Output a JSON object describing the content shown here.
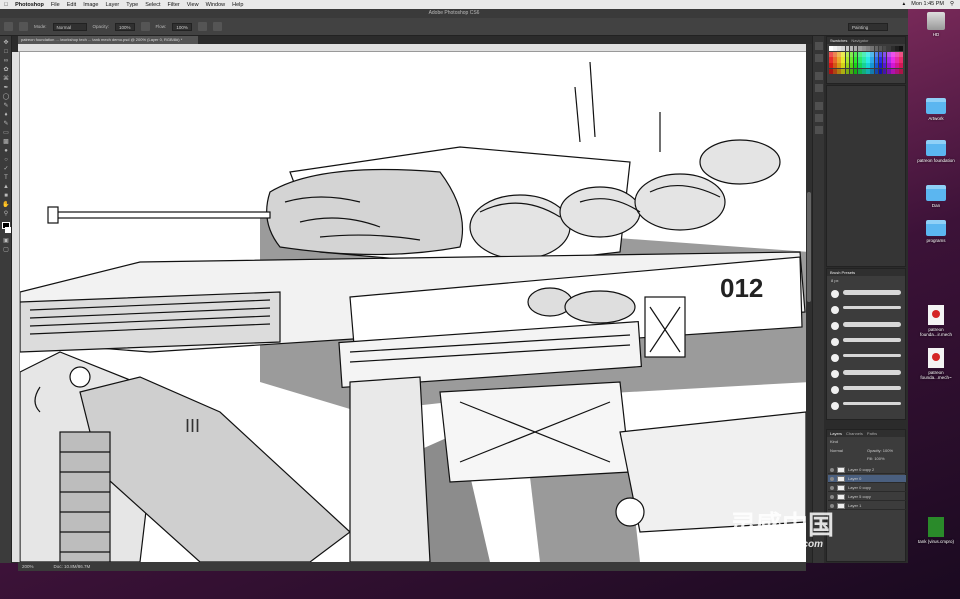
{
  "menubar": {
    "app": "Photoshop",
    "items": [
      "File",
      "Edit",
      "Image",
      "Layer",
      "Type",
      "Select",
      "Filter",
      "View",
      "Window",
      "Help"
    ],
    "clock": "Mon 1:45 PM"
  },
  "window": {
    "title": "Adobe Photoshop CS6"
  },
  "options": {
    "mode_label": "Mode:",
    "mode_value": "Normal",
    "opacity_label": "Opacity:",
    "opacity_value": "100%",
    "flow_label": "Flow:",
    "flow_value": "100%",
    "workspace": "Painting"
  },
  "document": {
    "tab_label": "patreon foundation ... /workshop tech ... tank mech demo.psd @ 200% (Layer 0, RGB/8#) *",
    "status_zoom": "200%",
    "status_doc": "Doc: 10.8M/86.7M"
  },
  "panels": {
    "swatches_tabs": [
      "Swatches",
      "Navigator"
    ],
    "brush_tabs": [
      "Brush Presets"
    ],
    "brush_size": "8 px",
    "layers_tabs": [
      "Layers",
      "Channels",
      "Paths"
    ],
    "layers_kind": "Kind",
    "layers_mode": "Normal",
    "layers_opacity": "Opacity: 100%",
    "layers_fill": "Fill: 100%",
    "layers": [
      "Layer 0 copy 2",
      "Layer 0",
      "Layer 0 copy",
      "Layer 5 copy",
      "Layer 1"
    ]
  },
  "desktop": {
    "items": [
      {
        "label": "HD",
        "kind": "hd"
      },
      {
        "label": "Artwork",
        "kind": "folder"
      },
      {
        "label": "patreon foundation",
        "kind": "folder"
      },
      {
        "label": "Dan",
        "kind": "folder"
      },
      {
        "label": "programs",
        "kind": "folder"
      },
      {
        "label": "patreon founda...ir.mech",
        "kind": "pdf"
      },
      {
        "label": "patreon founda...mech~",
        "kind": "pdf"
      },
      {
        "label": "tank (virus.cmpro)",
        "kind": "proj"
      }
    ]
  },
  "watermark": {
    "text": "灵感中国",
    "url": "lingganchina.com"
  },
  "colors": {
    "selected_layer": "#4a5f7f",
    "folder": "#5bb6f0",
    "pdf_badge": "#d42525"
  }
}
